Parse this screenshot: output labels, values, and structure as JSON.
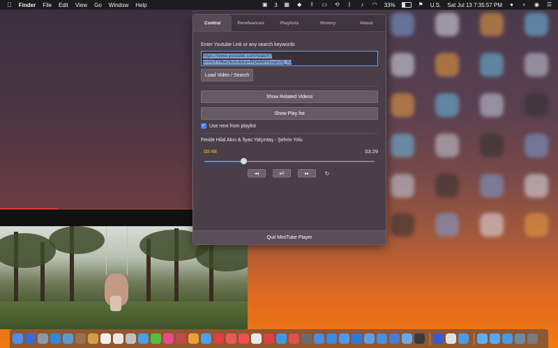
{
  "menubar": {
    "app_name": "Finder",
    "menus": [
      "File",
      "Edit",
      "View",
      "Go",
      "Window",
      "Help"
    ],
    "status": {
      "badge_count": "3",
      "battery_percent": "33%",
      "input_source": "U.S.",
      "datetime": "Sat Jul 13  7:35:57 PM"
    }
  },
  "panel": {
    "tabs": [
      {
        "label": "Control",
        "active": true
      },
      {
        "label": "Perefeances",
        "active": false
      },
      {
        "label": "Playlists",
        "active": false
      },
      {
        "label": "History",
        "active": false
      },
      {
        "label": "About",
        "active": false
      }
    ],
    "prompt_label": "Enter Youtube Link or any search keywords",
    "url_value_line1": "https://www.youtube.com/watch?",
    "url_value_line2": "v=HxTYReOILkc&list=RDMMYfuupU3j_IU",
    "load_button": "Load Video / Search",
    "related_button": "Show Related Videos",
    "playlist_button": "Show Play list",
    "use_next_label": "Use next from playlist",
    "use_next_checked": true,
    "now_playing": "Feride Hilal Akın & İlyas Yalçıntaş - Şehrin Yolu",
    "elapsed": "00:48",
    "duration": "03:29",
    "progress_fraction": 0.23,
    "controls": {
      "prev": "◂◂",
      "play_pause": "▸II",
      "next": "▸▸",
      "reload": "↻"
    },
    "quit_button": "Quit MiniTube Player"
  },
  "video": {
    "progress_fraction": 0.3
  }
}
